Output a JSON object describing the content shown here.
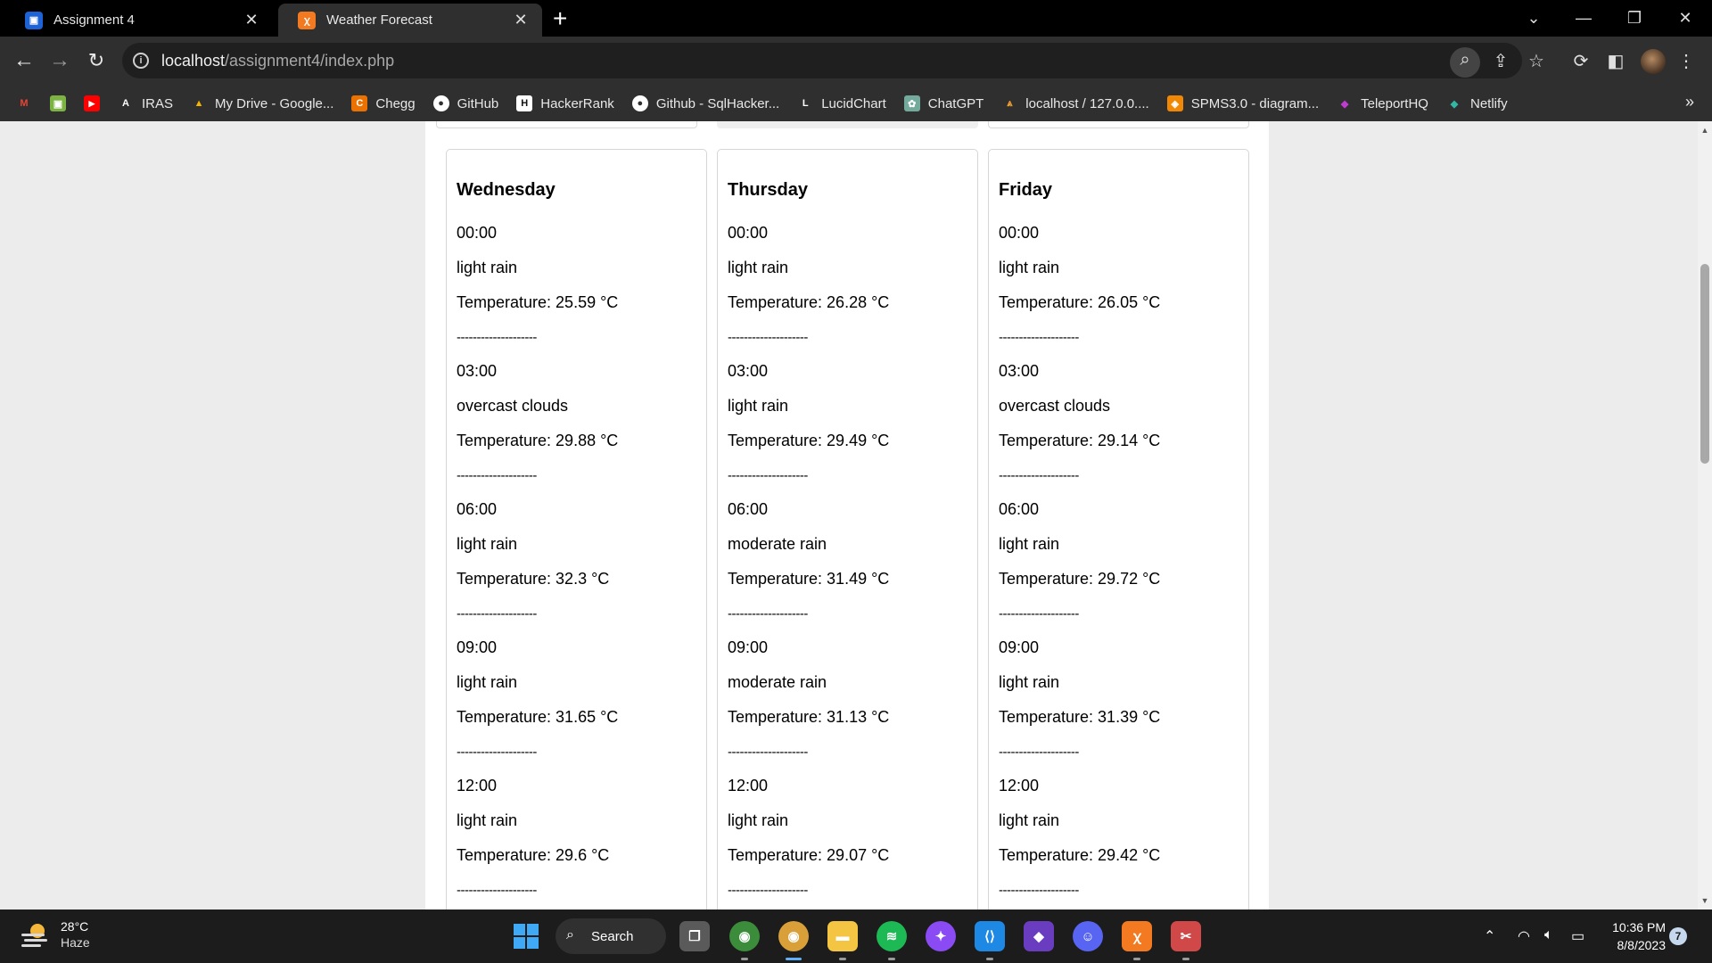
{
  "browser": {
    "tabs": [
      {
        "title": "Assignment 4",
        "icon": "classroom-icon",
        "color": "#1e63d6"
      },
      {
        "title": "Weather Forecast",
        "icon": "xampp-icon",
        "color": "#f37a21"
      }
    ],
    "url_host": "localhost",
    "url_path": "/assignment4/index.php",
    "bookmarks": [
      {
        "label": "",
        "icon": "gmail-icon",
        "color": "#ea4335",
        "glyph": "M"
      },
      {
        "label": "",
        "icon": "sheets-icon",
        "color": "#7cb342",
        "glyph": "▣"
      },
      {
        "label": "",
        "icon": "youtube-icon",
        "color": "#ff0000",
        "glyph": "▶"
      },
      {
        "label": "IRAS",
        "icon": "iras-icon",
        "color": "#2f2f2f",
        "glyph": "A"
      },
      {
        "label": "My Drive - Google...",
        "icon": "drive-icon",
        "color": "#2f2f2f",
        "glyph": "▲"
      },
      {
        "label": "Chegg",
        "icon": "chegg-icon",
        "color": "#eb7100",
        "glyph": "C"
      },
      {
        "label": "GitHub",
        "icon": "github-icon",
        "color": "#2f2f2f",
        "glyph": "●"
      },
      {
        "label": "HackerRank",
        "icon": "hackerrank-icon",
        "color": "#111111",
        "glyph": "H"
      },
      {
        "label": "Github - SqlHacker...",
        "icon": "github-icon",
        "color": "#2f2f2f",
        "glyph": "●"
      },
      {
        "label": "LucidChart",
        "icon": "lucidchart-icon",
        "color": "#2f2f2f",
        "glyph": "L"
      },
      {
        "label": "ChatGPT",
        "icon": "chatgpt-icon",
        "color": "#74aa9c",
        "glyph": "✿"
      },
      {
        "label": "localhost / 127.0.0....",
        "icon": "phpmyadmin-icon",
        "color": "#2f2f2f",
        "glyph": "⩓"
      },
      {
        "label": "SPMS3.0 - diagram...",
        "icon": "drawio-icon",
        "color": "#f08705",
        "glyph": "◈"
      },
      {
        "label": "TeleportHQ",
        "icon": "teleporthq-icon",
        "color": "#c13ad1",
        "glyph": "◆"
      },
      {
        "label": "Netlify",
        "icon": "netlify-icon",
        "color": "#32b6a6",
        "glyph": "◆"
      }
    ]
  },
  "forecast": {
    "separator": "--------------------",
    "days": [
      {
        "name": "Wednesday",
        "slots": [
          {
            "time": "00:00",
            "desc": "light rain",
            "temp": "Temperature: 25.59 °C"
          },
          {
            "time": "03:00",
            "desc": "overcast clouds",
            "temp": "Temperature: 29.88 °C"
          },
          {
            "time": "06:00",
            "desc": "light rain",
            "temp": "Temperature: 32.3 °C"
          },
          {
            "time": "09:00",
            "desc": "light rain",
            "temp": "Temperature: 31.65 °C"
          },
          {
            "time": "12:00",
            "desc": "light rain",
            "temp": "Temperature: 29.6 °C"
          }
        ]
      },
      {
        "name": "Thursday",
        "slots": [
          {
            "time": "00:00",
            "desc": "light rain",
            "temp": "Temperature: 26.28 °C"
          },
          {
            "time": "03:00",
            "desc": "light rain",
            "temp": "Temperature: 29.49 °C"
          },
          {
            "time": "06:00",
            "desc": "moderate rain",
            "temp": "Temperature: 31.49 °C"
          },
          {
            "time": "09:00",
            "desc": "moderate rain",
            "temp": "Temperature: 31.13 °C"
          },
          {
            "time": "12:00",
            "desc": "light rain",
            "temp": "Temperature: 29.07 °C"
          }
        ]
      },
      {
        "name": "Friday",
        "slots": [
          {
            "time": "00:00",
            "desc": "light rain",
            "temp": "Temperature: 26.05 °C"
          },
          {
            "time": "03:00",
            "desc": "overcast clouds",
            "temp": "Temperature: 29.14 °C"
          },
          {
            "time": "06:00",
            "desc": "light rain",
            "temp": "Temperature: 29.72 °C"
          },
          {
            "time": "09:00",
            "desc": "light rain",
            "temp": "Temperature: 31.39 °C"
          },
          {
            "time": "12:00",
            "desc": "light rain",
            "temp": "Temperature: 29.42 °C"
          }
        ]
      }
    ]
  },
  "taskbar": {
    "weather_temp": "28°C",
    "weather_cond": "Haze",
    "search_label": "Search",
    "apps": [
      {
        "name": "task-view-icon",
        "color": "#5a5a5a",
        "glyph": "❐"
      },
      {
        "name": "chrome-icon",
        "color": "#3b8d3b",
        "glyph": "◉"
      },
      {
        "name": "chrome-profile-icon",
        "color": "#d9a03a",
        "glyph": "◉"
      },
      {
        "name": "file-explorer-icon",
        "color": "#f4c542",
        "glyph": "▬"
      },
      {
        "name": "spotify-icon",
        "color": "#1db954",
        "glyph": "≋"
      },
      {
        "name": "messenger-icon",
        "color": "#8a4bf5",
        "glyph": "✦"
      },
      {
        "name": "vscode-icon",
        "color": "#1e88e5",
        "glyph": "⟨⟩"
      },
      {
        "name": "visual-studio-icon",
        "color": "#6a3cc0",
        "glyph": "◆"
      },
      {
        "name": "discord-icon",
        "color": "#5865f2",
        "glyph": "☺"
      },
      {
        "name": "xampp-icon",
        "color": "#f37a21",
        "glyph": "ꭓ"
      },
      {
        "name": "snipping-tool-icon",
        "color": "#d04848",
        "glyph": "✂"
      }
    ],
    "time": "10:36 PM",
    "date": "8/8/2023",
    "notification_count": "7"
  }
}
